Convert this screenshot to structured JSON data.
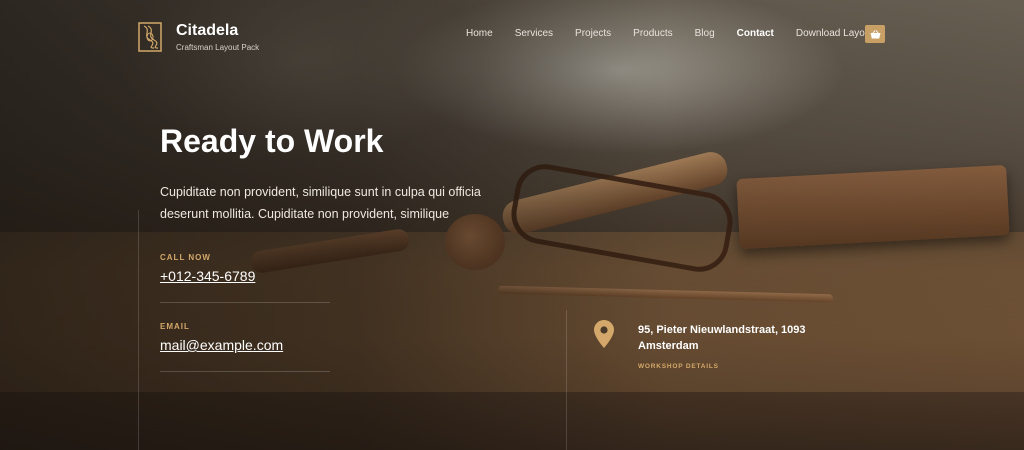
{
  "brand": {
    "title": "Citadela",
    "subtitle": "Craftsman Layout Pack"
  },
  "nav": {
    "items": [
      {
        "label": "Home"
      },
      {
        "label": "Services"
      },
      {
        "label": "Projects"
      },
      {
        "label": "Products"
      },
      {
        "label": "Blog"
      },
      {
        "label": "Contact",
        "active": true
      },
      {
        "label": "Download Layout"
      }
    ],
    "cart_icon": "shopping-basket-icon"
  },
  "hero": {
    "title": "Ready to Work",
    "text": "Cupiditate non provident, similique sunt in culpa qui officia deserunt mollitia. Cupiditate non provident, similique"
  },
  "contact": {
    "call_label": "CALL NOW",
    "phone": "+012-345-6789",
    "email_label": "EMAIL",
    "email": "mail@example.com",
    "address_line1": "95, Pieter Nieuwlandstraat, 1093",
    "address_line2": "Amsterdam",
    "workshop_label": "WORKSHOP DETAILS",
    "location_icon": "map-pin-icon"
  },
  "colors": {
    "accent": "#c8a065",
    "label": "#d3a86a"
  }
}
